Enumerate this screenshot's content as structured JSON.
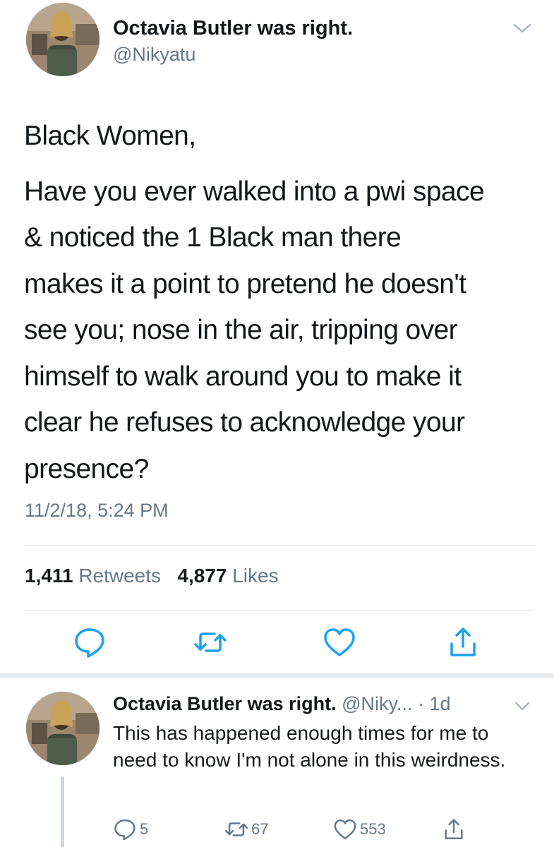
{
  "tweet": {
    "display_name": "Octavia Butler was right.",
    "handle": "@Nikyatu",
    "greeting": "Black Women,",
    "body_lines": [
      "Have you ever walked into a pwi space",
      "& noticed the 1 Black man there",
      "makes it a point to pretend he doesn't",
      "see you; nose in the air, tripping over",
      "himself to walk around you to make it",
      "clear he refuses to acknowledge your",
      "presence?"
    ],
    "timestamp": "11/2/18, 5:24 PM",
    "retweets_count": "1,411",
    "retweets_label": "Retweets",
    "likes_count": "4,877",
    "likes_label": "Likes"
  },
  "reply": {
    "display_name": "Octavia Butler was right.",
    "handle": "@Niky...",
    "age": "· 1d",
    "text": "This has happened enough times for me to need to know I'm not alone in this weirdness.",
    "reply_count": "5",
    "retweet_count": "67",
    "like_count": "553"
  },
  "colors": {
    "text": "#14171a",
    "secondary": "#657786",
    "divider": "#e1e8ed",
    "icon": "#1da1f2"
  },
  "icons": [
    "chevron-down-icon",
    "reply-icon",
    "retweet-icon",
    "like-icon",
    "share-icon"
  ]
}
